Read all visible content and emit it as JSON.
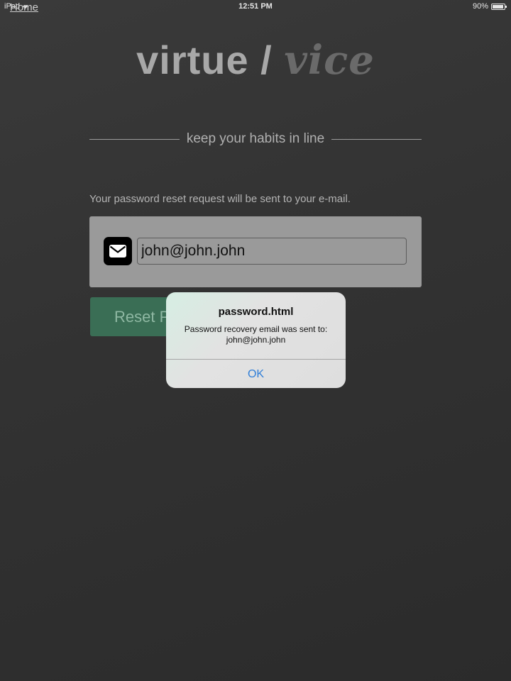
{
  "status_bar": {
    "device": "iPad",
    "home_link": "Home",
    "time": "12:51 PM",
    "battery": "90%",
    "battery_level": 0.9
  },
  "logo": {
    "part1": "virtue",
    "separator": " / ",
    "part2": "vice"
  },
  "tagline": "keep your habits in line",
  "instruction": "Your password reset request will be sent to your e-mail.",
  "email_field": {
    "value": "john@john.john",
    "icon": "mail-icon"
  },
  "reset_button": {
    "label": "Reset Password"
  },
  "alert": {
    "title": "password.html",
    "message_line1": "Password recovery email was sent to:",
    "message_line2": "john@john.john",
    "ok_label": "OK"
  },
  "colors": {
    "background": "#333333",
    "panel": "#9a9a9a",
    "button": "#3a6e55",
    "alert_ok": "#2f7ed8"
  }
}
